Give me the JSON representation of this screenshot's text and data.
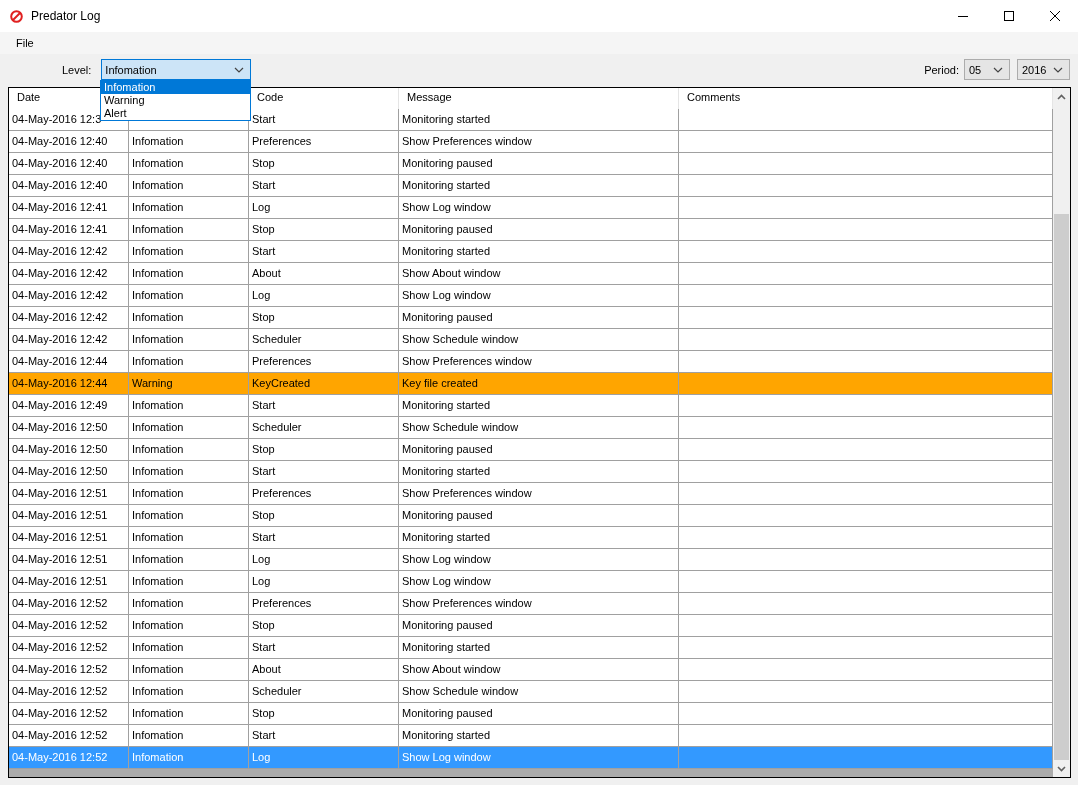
{
  "window": {
    "title": "Predator Log"
  },
  "menu": [
    "File"
  ],
  "filter": {
    "label": "Level:",
    "value": "Infomation",
    "options": [
      {
        "label": "Infomation",
        "selected": true
      },
      {
        "label": "Warning",
        "selected": false
      },
      {
        "label": "Alert",
        "selected": false
      }
    ]
  },
  "period": {
    "label": "Period:",
    "month": "05",
    "year": "2016"
  },
  "table": {
    "columns": {
      "date": "Date",
      "code": "Code",
      "message": "Message",
      "comments": "Comments"
    },
    "rows": [
      {
        "date": "04-May-2016 12:3",
        "code": "Start",
        "message": "Monitoring started",
        "selected": false
      },
      {
        "date": "04-May-2016 12:40",
        "level": "Infomation",
        "code": "Preferences",
        "message": "Show Preferences window",
        "selected": false
      },
      {
        "date": "04-May-2016 12:40",
        "level": "Infomation",
        "code": "Stop",
        "message": "Monitoring paused",
        "selected": false
      },
      {
        "date": "04-May-2016 12:40",
        "level": "Infomation",
        "code": "Start",
        "message": "Monitoring started",
        "selected": false
      },
      {
        "date": "04-May-2016 12:41",
        "level": "Infomation",
        "code": "Log",
        "message": "Show Log window",
        "selected": false
      },
      {
        "date": "04-May-2016 12:41",
        "level": "Infomation",
        "code": "Stop",
        "message": "Monitoring paused",
        "selected": false
      },
      {
        "date": "04-May-2016 12:42",
        "level": "Infomation",
        "code": "Start",
        "message": "Monitoring started",
        "selected": false
      },
      {
        "date": "04-May-2016 12:42",
        "level": "Infomation",
        "code": "About",
        "message": "Show About window",
        "selected": false
      },
      {
        "date": "04-May-2016 12:42",
        "level": "Infomation",
        "code": "Log",
        "message": "Show Log window",
        "selected": false
      },
      {
        "date": "04-May-2016 12:42",
        "level": "Infomation",
        "code": "Stop",
        "message": "Monitoring paused",
        "selected": false
      },
      {
        "date": "04-May-2016 12:42",
        "level": "Infomation",
        "code": "Scheduler",
        "message": "Show Schedule window",
        "selected": false
      },
      {
        "date": "04-May-2016 12:44",
        "level": "Infomation",
        "code": "Preferences",
        "message": "Show Preferences window",
        "selected": false
      },
      {
        "date": "04-May-2016 12:44",
        "level": "Warning",
        "code": "KeyCreated",
        "message": "Key file created",
        "selected": false,
        "color": "#ffa500"
      },
      {
        "date": "04-May-2016 12:49",
        "level": "Infomation",
        "code": "Start",
        "message": "Monitoring started",
        "selected": false
      },
      {
        "date": "04-May-2016 12:50",
        "level": "Infomation",
        "code": "Scheduler",
        "message": "Show Schedule window",
        "selected": false
      },
      {
        "date": "04-May-2016 12:50",
        "level": "Infomation",
        "code": "Stop",
        "message": "Monitoring paused",
        "selected": false
      },
      {
        "date": "04-May-2016 12:50",
        "level": "Infomation",
        "code": "Start",
        "message": "Monitoring started",
        "selected": false
      },
      {
        "date": "04-May-2016 12:51",
        "level": "Infomation",
        "code": "Preferences",
        "message": "Show Preferences window",
        "selected": false
      },
      {
        "date": "04-May-2016 12:51",
        "level": "Infomation",
        "code": "Stop",
        "message": "Monitoring paused",
        "selected": false
      },
      {
        "date": "04-May-2016 12:51",
        "level": "Infomation",
        "code": "Start",
        "message": "Monitoring started",
        "selected": false
      },
      {
        "date": "04-May-2016 12:51",
        "level": "Infomation",
        "code": "Log",
        "message": "Show Log window",
        "selected": false
      },
      {
        "date": "04-May-2016 12:51",
        "level": "Infomation",
        "code": "Log",
        "message": "Show Log window",
        "selected": false
      },
      {
        "date": "04-May-2016 12:52",
        "level": "Infomation",
        "code": "Preferences",
        "message": "Show Preferences window",
        "selected": false
      },
      {
        "date": "04-May-2016 12:52",
        "level": "Infomation",
        "code": "Stop",
        "message": "Monitoring paused",
        "selected": false
      },
      {
        "date": "04-May-2016 12:52",
        "level": "Infomation",
        "code": "Start",
        "message": "Monitoring started",
        "selected": false
      },
      {
        "date": "04-May-2016 12:52",
        "level": "Infomation",
        "code": "About",
        "message": "Show About window",
        "selected": false
      },
      {
        "date": "04-May-2016 12:52",
        "level": "Infomation",
        "code": "Scheduler",
        "message": "Show Schedule window",
        "selected": false
      },
      {
        "date": "04-May-2016 12:52",
        "level": "Infomation",
        "code": "Stop",
        "message": "Monitoring paused",
        "selected": false
      },
      {
        "date": "04-May-2016 12:52",
        "level": "Infomation",
        "code": "Start",
        "message": "Monitoring started",
        "selected": false
      },
      {
        "date": "04-May-2016 12:52",
        "level": "Infomation",
        "code": "Log",
        "message": "Show Log window",
        "selected": true
      }
    ]
  }
}
